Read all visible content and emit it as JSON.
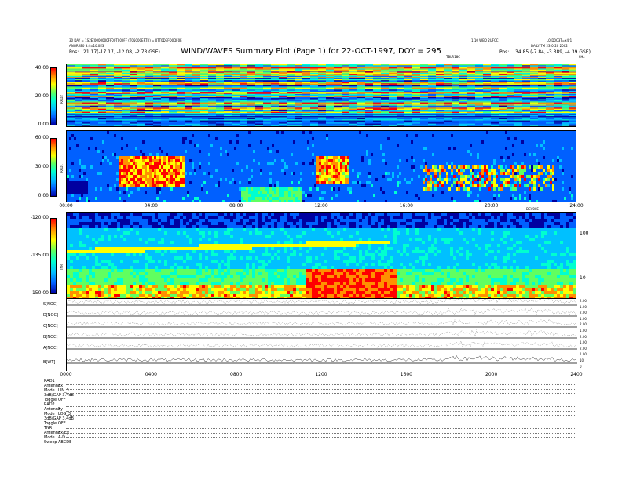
{
  "header": {
    "title": "WIND/WAVES Summary Plot (Page 1) for 22-OCT-1997, DOY = 295",
    "left_line1": "30 DAY = 1S2E(0000000FF00T000FF (T05000ERTI)) = 0TT0DEFQ0DF0E",
    "left_line2": "ANGRRE0 3.4=10.0E3",
    "left_pos_label": "Pos:",
    "left_pos": "21.17(-17.17, -12.08, -2.73 GSE)",
    "right_line1": "1.10 WBD 2UFCC",
    "right_line2": "L0(D0C3T=x4r1",
    "right_line3": "DAILY TM 23(0)20 2002",
    "right_pos_label": "Pos:",
    "right_pos": "34.85 (-7.84, -3.389, -4.39 GSE)",
    "tbl_label": "TBLR18C",
    "unit_label": "kHz"
  },
  "chart_data": [
    {
      "type": "heatmap",
      "panel": "RAD2",
      "ylabel": "RAD2",
      "ylim": [
        0.0,
        40.0
      ],
      "yticks": [
        "40.00",
        "20.00",
        "0.00"
      ],
      "colormap": [
        "#0000a0",
        "#0060ff",
        "#00c0ff",
        "#00ffd0",
        "#60ff60",
        "#ffff00",
        "#ff9000",
        "#ff0000"
      ]
    },
    {
      "type": "heatmap",
      "panel": "RAD1",
      "ylabel": "RAD1",
      "ylim": [
        0.0,
        60.0
      ],
      "yticks": [
        "60.00",
        "30.00",
        "0.00"
      ],
      "xticks": [
        "00:00",
        "04:00",
        "08:00",
        "12:00",
        "16:00",
        "20:00",
        "24:00"
      ],
      "xlabel_right": "DEV00E"
    },
    {
      "type": "heatmap",
      "panel": "TNR",
      "ylabel": "TNR",
      "ylim": [
        -150.0,
        -120.0
      ],
      "yticks": [
        "-120.00",
        "-135.00",
        "-150.00"
      ],
      "right_ticks": [
        "100",
        "10"
      ]
    },
    {
      "type": "line",
      "panel": "traces",
      "series": [
        {
          "name": "S[NOC]"
        },
        {
          "name": "D[NOC]"
        },
        {
          "name": "C[NOC]"
        },
        {
          "name": "B[NOC]"
        },
        {
          "name": "A[NOC]"
        },
        {
          "name": "B[WT]"
        }
      ],
      "right_ticks": [
        "2.00",
        "1.00",
        "2.00",
        "1.00",
        "2.00",
        "1.00",
        "2.00",
        "1.00",
        "2.00",
        "1.00",
        "10",
        "0"
      ],
      "xticks": [
        "0000",
        "0400",
        "0800",
        "1200",
        "1600",
        "2000",
        "2400"
      ]
    }
  ],
  "config": {
    "rad1_header": "RAD1",
    "rad1_rows": [
      [
        "Antenna",
        "Ex"
      ],
      [
        "Mode",
        "LIN_3"
      ],
      [
        "3dB/GAP 3.4dB",
        ""
      ],
      [
        "Toggle",
        "OFF"
      ]
    ],
    "rad2_header": "RAD2",
    "rad2_rows": [
      [
        "Antenna",
        "Ey"
      ],
      [
        "Mode",
        "LOG_3"
      ],
      [
        "3dB/GAP 3.4dB",
        ""
      ],
      [
        "Toggle",
        "OFF"
      ]
    ],
    "tnr_header": "TNR",
    "tnr_rows": [
      [
        "Antenna",
        "Ex/Ey"
      ],
      [
        "Mode",
        "A-D"
      ],
      [
        "Sweep",
        "ABCDE"
      ]
    ]
  }
}
